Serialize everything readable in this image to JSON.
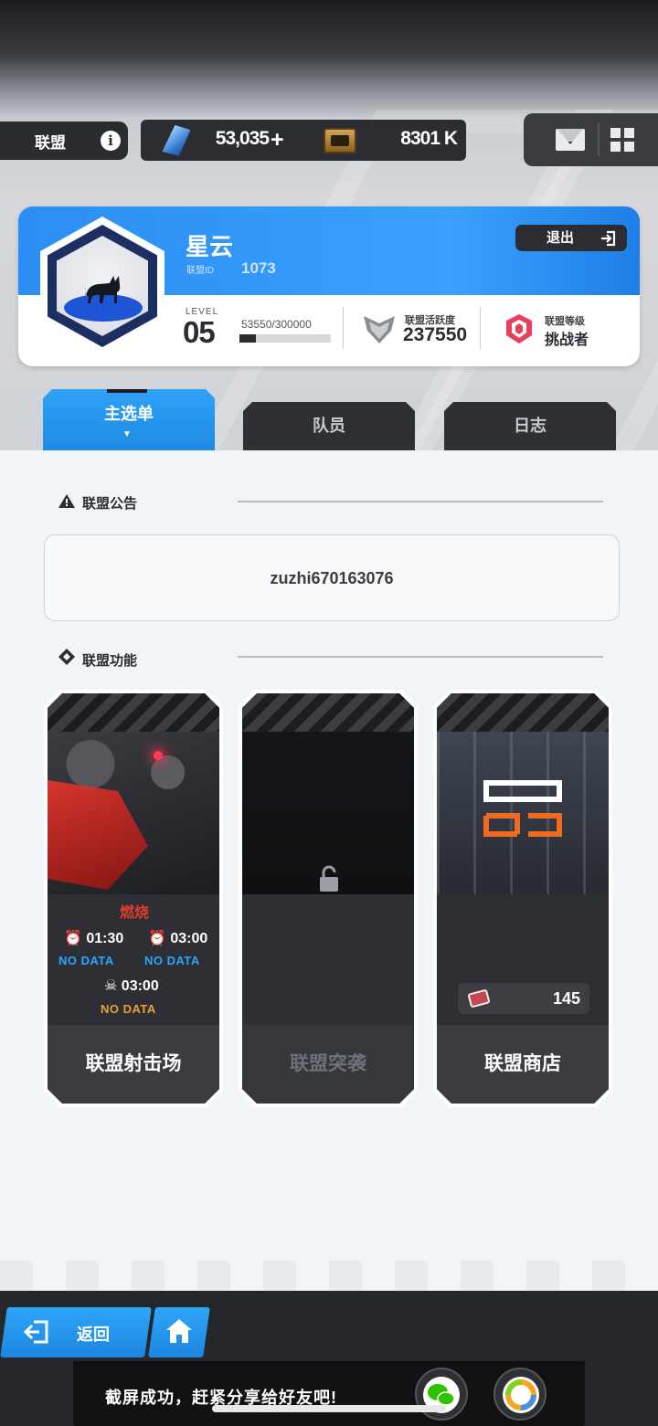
{
  "header": {
    "title": "联盟",
    "info_icon": "info-icon",
    "resources": [
      {
        "icon": "crystal-icon",
        "value": "53,035",
        "add_icon": "plus-icon"
      },
      {
        "icon": "gold-chest-icon",
        "value": "8301 K"
      }
    ],
    "right_icons": [
      "mail-icon",
      "grid-menu-icon"
    ]
  },
  "alliance": {
    "name": "星云",
    "id_label": "联盟ID",
    "id": "1073",
    "exit_label": "退出",
    "level_label": "LEVEL",
    "level": "05",
    "xp_text": "53550/300000",
    "xp_current": 53550,
    "xp_max": 300000,
    "activity_label": "联盟活跃度",
    "activity_value": "237550",
    "rank_label": "联盟等级",
    "rank_value": "挑战者",
    "emblem_icon": "cat-emblem-icon"
  },
  "tabs": [
    {
      "label": "主选单",
      "active": true
    },
    {
      "label": "队员",
      "active": false
    },
    {
      "label": "日志",
      "active": false
    }
  ],
  "notice": {
    "title": "联盟公告",
    "text": "zuzhi670163076"
  },
  "functions": {
    "title": "联盟功能",
    "cards": [
      {
        "title": "联盟射击场",
        "status": "燃烧",
        "timers": [
          {
            "time": "01:30",
            "data": "NO DATA"
          },
          {
            "time": "03:00",
            "data": "NO DATA"
          }
        ],
        "boss_timer": {
          "time": "03:00",
          "data": "NO DATA"
        }
      },
      {
        "title": "联盟突袭",
        "locked": true
      },
      {
        "title": "联盟商店",
        "currency_icon": "ticket-icon",
        "count": "145"
      }
    ]
  },
  "bottom": {
    "back_label": "返回",
    "home_icon": "home-icon",
    "toast": "截屏成功，赶紧分享给好友吧!",
    "share_icons": [
      "wechat-icon",
      "photos-icon"
    ]
  },
  "colors": {
    "accent_blue": "#2c8ef2",
    "dark_panel": "#2d2f34",
    "danger_red": "#e03a30",
    "nodata_blue": "#2aa6ff",
    "nodata_orange": "#e9a233"
  }
}
